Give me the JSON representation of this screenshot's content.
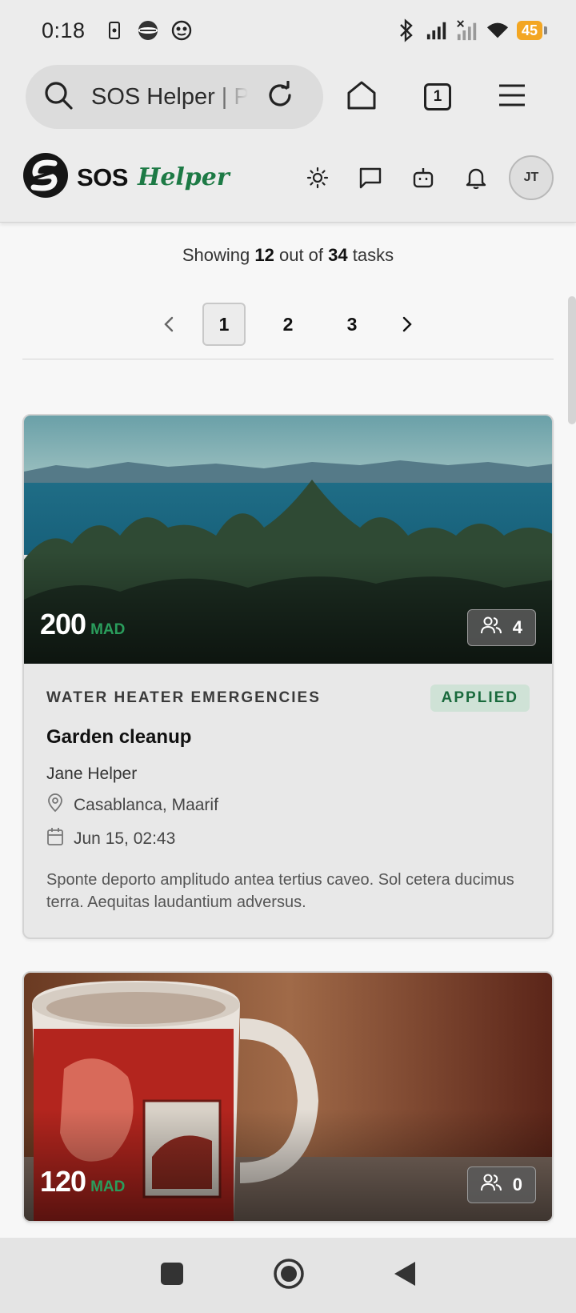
{
  "status": {
    "time": "0:18",
    "battery": "45"
  },
  "browser": {
    "url_text": "SOS Helper | Platform",
    "tab_count": "1"
  },
  "app": {
    "logo_text": "SOS",
    "logo_accent": "Helper",
    "avatar_initials": "JT"
  },
  "list": {
    "showing_prefix": "Showing",
    "shown": "12",
    "out_of": "out of",
    "total": "34",
    "suffix": "tasks"
  },
  "pagination": {
    "pages": [
      "1",
      "2",
      "3"
    ],
    "active": "1"
  },
  "cards": [
    {
      "price": "200",
      "currency": "MAD",
      "applicants": "4",
      "category": "WATER HEATER EMERGENCIES",
      "badge": "APPLIED",
      "title": "Garden cleanup",
      "helper": "Jane Helper",
      "location": "Casablanca, Maarif",
      "date": "Jun 15, 02:43",
      "description": "Sponte deporto amplitudo antea tertius caveo. Sol cetera ducimus terra. Aequitas laudantium adversus."
    },
    {
      "price": "120",
      "currency": "MAD",
      "applicants": "0"
    }
  ],
  "colors": {
    "accent": "#1d7a45",
    "badge_bg": "#cfe2d6",
    "battery": "#f3a622"
  },
  "icons": [
    "search-icon",
    "reload-icon",
    "home-icon",
    "tabs-icon",
    "menu-icon",
    "sun-icon",
    "chat-icon",
    "bot-icon",
    "bell-icon",
    "people-icon",
    "location-icon",
    "calendar-icon",
    "chevron-left-icon",
    "chevron-right-icon"
  ]
}
